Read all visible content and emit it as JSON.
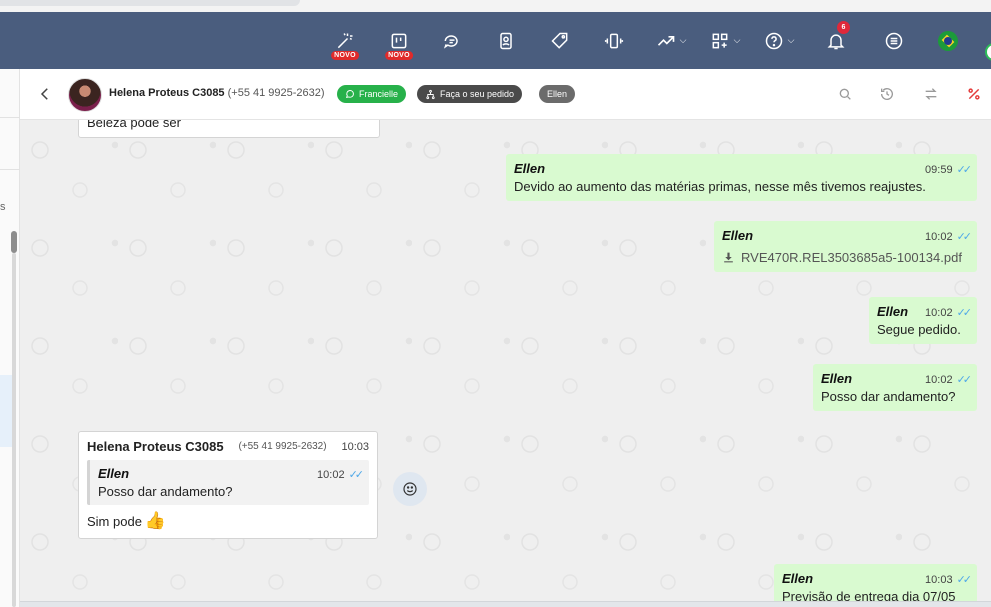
{
  "nav": {
    "items": [
      {
        "name": "magic-wand",
        "badge": "NOVO"
      },
      {
        "name": "kanban-board",
        "badge": "NOVO"
      },
      {
        "name": "chat-bubbles"
      },
      {
        "name": "contact-card"
      },
      {
        "name": "tag"
      },
      {
        "name": "vibrating-phone"
      },
      {
        "name": "trending-up",
        "dropdown": true
      },
      {
        "name": "apps-grid",
        "dropdown": true
      },
      {
        "name": "help",
        "dropdown": true
      },
      {
        "name": "bell",
        "count": "6"
      },
      {
        "name": "menu-list"
      },
      {
        "name": "brazil-flag"
      }
    ]
  },
  "sidebar": {
    "fragment": "s"
  },
  "header": {
    "contact_name": "Helena Proteus C3085",
    "contact_phone": "(+55 41 9925-2632)",
    "tags": [
      "Francielle",
      "Faça o seu pedido",
      "Ellen"
    ],
    "tools": [
      "search-icon",
      "history-icon",
      "transfer-icon",
      "percent-icon"
    ]
  },
  "messages": {
    "prev_text": "Beleza pode ser",
    "m1": {
      "author": "Ellen",
      "time": "09:59",
      "text": "Devido ao aumento das matérias primas, nesse mês tivemos reajustes."
    },
    "m2": {
      "author": "Ellen",
      "time": "10:02",
      "file": "RVE470R.REL3503685a5-100134.pdf"
    },
    "m3": {
      "author": "Ellen",
      "time": "10:02",
      "text": "Segue pedido."
    },
    "m4": {
      "author": "Ellen",
      "time": "10:02",
      "text": "Posso dar andamento?"
    },
    "reply": {
      "author": "Helena Proteus C3085",
      "phone": "(+55 41 9925-2632)",
      "time": "10:03",
      "quote_author": "Ellen",
      "quote_time": "10:02",
      "quote_text": "Posso dar andamento?",
      "text": "Sim pode",
      "emoji": "👍"
    },
    "m5": {
      "author": "Ellen",
      "time": "10:03",
      "text": "Previsão de entrega dia 07/05"
    }
  },
  "colors": {
    "nav_bg": "#4a5d7e",
    "out_bubble": "#d9fad0",
    "tag_green": "#27b14a",
    "read_ticks": "#4fa8e8"
  }
}
